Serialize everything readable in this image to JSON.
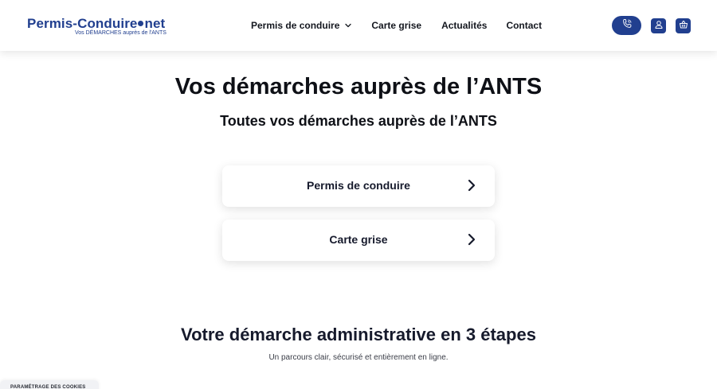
{
  "header": {
    "logo_name": "Permis-Conduire",
    "logo_suffix": "net",
    "logo_tagline": "Vos DÉMARCHES auprès de l'ANTS",
    "nav": [
      {
        "label": "Permis de conduire",
        "has_dropdown": true
      },
      {
        "label": "Carte grise"
      },
      {
        "label": "Actualités"
      },
      {
        "label": "Contact"
      }
    ],
    "icons": {
      "phone": "phone-icon",
      "user": "user-icon",
      "basket": "basket-icon"
    },
    "brand_color": "#213f8f"
  },
  "hero": {
    "title": "Vos démarches auprès de l’ANTS",
    "subtitle": "Toutes vos démarches auprès de l’ANTS"
  },
  "cards": [
    {
      "label": "Permis de conduire",
      "icon": "chevron-right-icon"
    },
    {
      "label": "Carte grise",
      "icon": "chevron-right-icon"
    }
  ],
  "steps": {
    "title": "Votre démarche administrative en 3 étapes",
    "subtitle": "Un parcours clair, sécurisé et entièrement en ligne."
  },
  "cookie": {
    "label": "PARAMÉTRAGE DES COOKIES"
  }
}
